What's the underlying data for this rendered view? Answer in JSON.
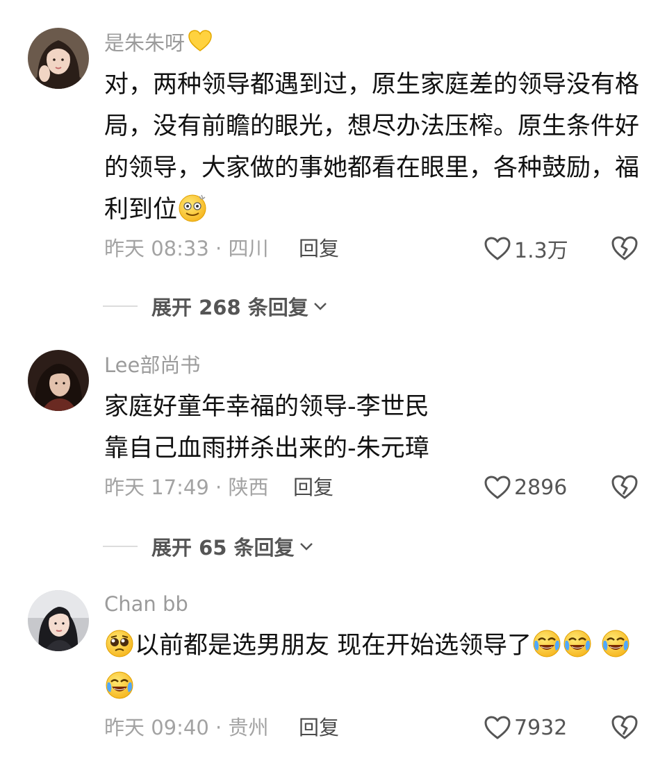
{
  "comments": [
    {
      "username": "是朱朱呀",
      "username_emoji": "yellow-heart",
      "text": "对，两种领导都遇到过，原生家庭差的领导没有格局，没有前瞻的眼光，想尽办法压榨。原生条件好的领导，大家做的事她都看在眼里，各种鼓励，福利到位",
      "trailing_emoji": "dizzy-face-emoji",
      "time": "昨天 08:33 · 四川",
      "reply": "回复",
      "likes": "1.3万",
      "expand": "展开 268 条回复"
    },
    {
      "username": "Lee部尚书",
      "lines": [
        "家庭好童年幸福的领导-李世民",
        "靠自己血雨拼杀出来的-朱元璋"
      ],
      "time": "昨天 17:49 · 陕西",
      "reply": "回复",
      "likes": "2896",
      "expand": "展开 65 条回复"
    },
    {
      "username": "Chan bb",
      "leading_emoji": "pleading-face-emoji",
      "text": "以前都是选男朋友 现在开始选领导了",
      "trailing_emojis": [
        "crying-laughing-emoji",
        "crying-laughing-emoji",
        "crying-laughing-emoji",
        "crying-laughing-emoji"
      ],
      "time": "昨天 09:40 · 贵州",
      "reply": "回复",
      "likes": "7932"
    }
  ],
  "colors": {
    "username": "#9b9b9b",
    "meta": "#a3a3a3",
    "text": "#111111",
    "emoji_yellow": "#fcd34d"
  }
}
